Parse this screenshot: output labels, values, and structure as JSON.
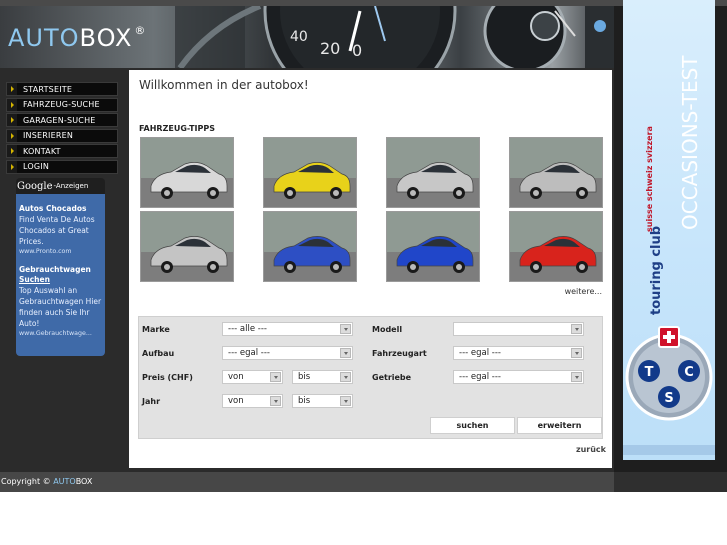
{
  "logo": {
    "part1": "AUTO",
    "part2": "BOX",
    "mark": "®"
  },
  "nav": {
    "items": [
      {
        "label": "STARTSEITE"
      },
      {
        "label": "FAHRZEUG-SUCHE"
      },
      {
        "label": "GARAGEN-SUCHE"
      },
      {
        "label": "INSERIEREN"
      },
      {
        "label": "KONTAKT"
      },
      {
        "label": "LOGIN"
      }
    ]
  },
  "ads": {
    "header_google": "Google",
    "header_label": "-Anzeigen",
    "items": [
      {
        "title": "Autos Chocados",
        "text": "Find Venta De Autos Chocados at Great Prices.",
        "url": "www.Pronto.com"
      },
      {
        "title": "Gebrauchtwagen",
        "title2": "Suchen",
        "text": "Top Auswahl an Gebrauchtwagen Hier finden auch Sie Ihr Auto!",
        "url": "www.Gebrauchtwage..."
      }
    ]
  },
  "main": {
    "welcome": "Willkommen in der autobox!",
    "tipps_heading": "FAHRZEUG-TIPPS",
    "more_link": "weitere...",
    "back_link": "zurück"
  },
  "thumbnails": [
    {
      "car": "silver classic coupe",
      "color": "#d8d8d8"
    },
    {
      "car": "yellow corvette",
      "color": "#e8d21a"
    },
    {
      "car": "silver corvette",
      "color": "#c7c7c7"
    },
    {
      "car": "silver camaro",
      "color": "#bdbdbd"
    },
    {
      "car": "silver pt cruiser",
      "color": "#c4c4c4"
    },
    {
      "car": "blue viper",
      "color": "#2d4fc4"
    },
    {
      "car": "blue convertible",
      "color": "#2046c9"
    },
    {
      "car": "red firebird",
      "color": "#d8231c"
    }
  ],
  "search": {
    "marke_label": "Marke",
    "marke_value": "--- alle ---",
    "modell_label": "Modell",
    "modell_value": "",
    "aufbau_label": "Aufbau",
    "aufbau_value": "--- egal ---",
    "fahrzeugart_label": "Fahrzeugart",
    "fahrzeugart_value": "--- egal ---",
    "preis_label": "Preis (CHF)",
    "preis_von": "von",
    "preis_bis": "bis",
    "getriebe_label": "Getriebe",
    "getriebe_value": "--- egal ---",
    "jahr_label": "Jahr",
    "jahr_von": "von",
    "jahr_bis": "bis",
    "search_button": "suchen",
    "extend_button": "erweitern"
  },
  "banner": {
    "title": "OCCASIONS-TEST",
    "subtitle": "suisse schweiz svizzera",
    "club": "touring club",
    "badge_letters": [
      "T",
      "C",
      "S"
    ],
    "accent": "#c0182b"
  },
  "footer": {
    "copyright_prefix": "Copyright © ",
    "brand1": "AUTO",
    "brand2": "BOX"
  }
}
